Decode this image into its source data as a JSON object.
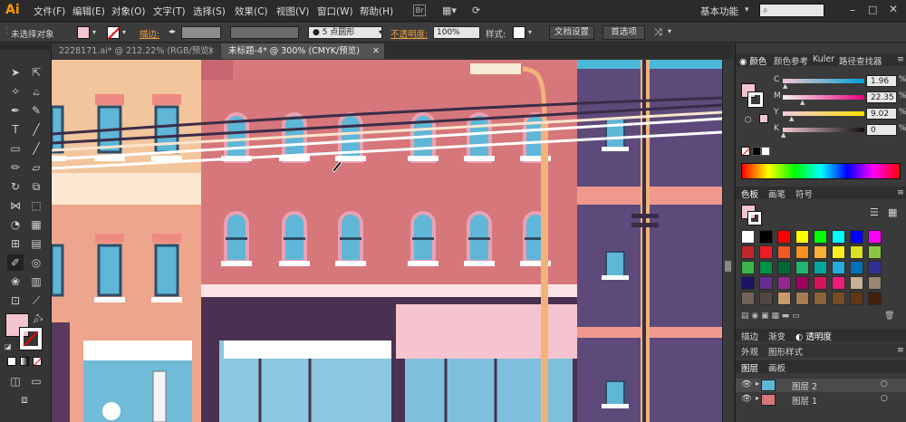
{
  "menubar": {
    "logo": "Ai",
    "items": [
      "文件(F)",
      "编辑(E)",
      "对象(O)",
      "文字(T)",
      "选择(S)",
      "效果(C)",
      "视图(V)",
      "窗口(W)",
      "帮助(H)"
    ],
    "workspace": "基本功能"
  },
  "controlbar": {
    "selection_label": "未选择对象",
    "stroke_label": "描边:",
    "brush_label": "5 点圆形",
    "opacity_label": "不透明度:",
    "opacity_value": "100%",
    "style_label": "样式:",
    "doc_setup": "文档设置",
    "preferences": "首选项"
  },
  "tabs": [
    {
      "label": "2228171.ai* @ 212.22% (RGB/预览)",
      "active": false
    },
    {
      "label": "未标题-4* @ 300% (CMYK/预览)",
      "active": true
    }
  ],
  "panels": {
    "color_tabs": [
      "颜色",
      "颜色参考",
      "Kuler",
      "路径查找器"
    ],
    "cmyk": [
      {
        "channel": "C",
        "value": "1.96",
        "unit": "%"
      },
      {
        "channel": "M",
        "value": "22.35",
        "unit": "%"
      },
      {
        "channel": "Y",
        "value": "9.02",
        "unit": "%"
      },
      {
        "channel": "K",
        "value": "0",
        "unit": "%"
      }
    ],
    "swatch_tabs": [
      "色板",
      "画笔",
      "符号"
    ],
    "lower_tabs": [
      "描边",
      "渐变",
      "透明度"
    ],
    "appearance_tabs": [
      "外观",
      "图形样式"
    ],
    "layer_tabs": [
      "图层",
      "画板"
    ],
    "layers": [
      "图层 2",
      "图层 1"
    ]
  },
  "colors": {
    "accent_fill": "#f4c5cf",
    "swatches": [
      "#ffffff",
      "#000000",
      "#ff0000",
      "#ffff00",
      "#00ff00",
      "#00ffff",
      "#0000ff",
      "#ff00ff",
      "#c1272d",
      "#ed1c24",
      "#f15a24",
      "#f7931e",
      "#fbb03b",
      "#fcee21",
      "#d9e021",
      "#8cc63f",
      "#39b54a",
      "#009245",
      "#006837",
      "#22b573",
      "#00a99d",
      "#29abe2",
      "#0071bc",
      "#2e3192",
      "#1b1464",
      "#662d91",
      "#93278f",
      "#9e005d",
      "#d4145a",
      "#ed1e79",
      "#c7b299",
      "#998675",
      "#736357",
      "#534741",
      "#c69c6d",
      "#a67c52",
      "#8c6239",
      "#754c24",
      "#603813",
      "#42210b"
    ]
  }
}
